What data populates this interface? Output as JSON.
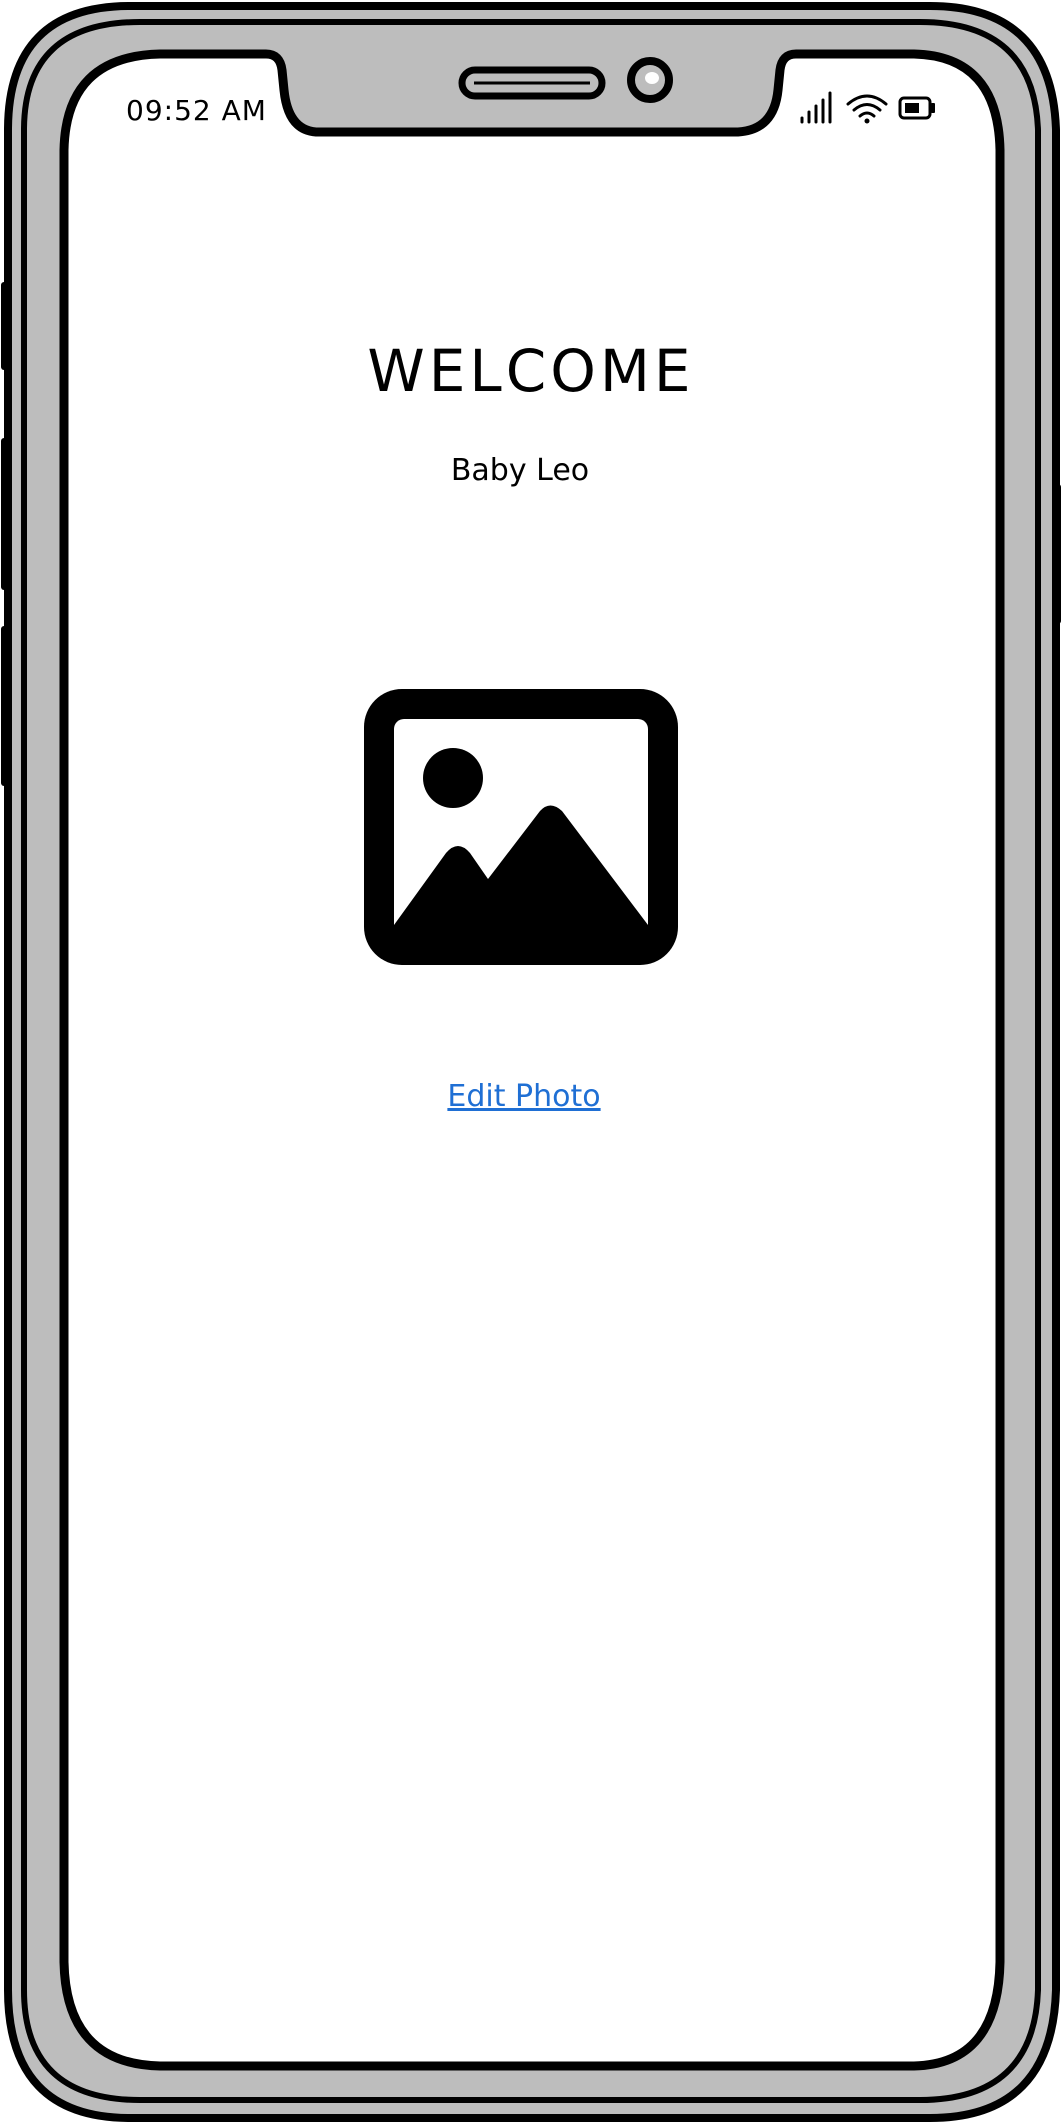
{
  "status_bar": {
    "time": "09:52 AM",
    "icons": [
      "signal-icon",
      "wifi-icon",
      "battery-icon"
    ]
  },
  "main": {
    "title": "WELCOME",
    "subtitle": "Baby Leo",
    "photo_icon": "image-placeholder-icon",
    "edit_photo_label": "Edit Photo"
  },
  "colors": {
    "frame_fill": "#bdbdbd",
    "outline": "#000000",
    "screen": "#ffffff",
    "link": "#1f6fd4"
  }
}
